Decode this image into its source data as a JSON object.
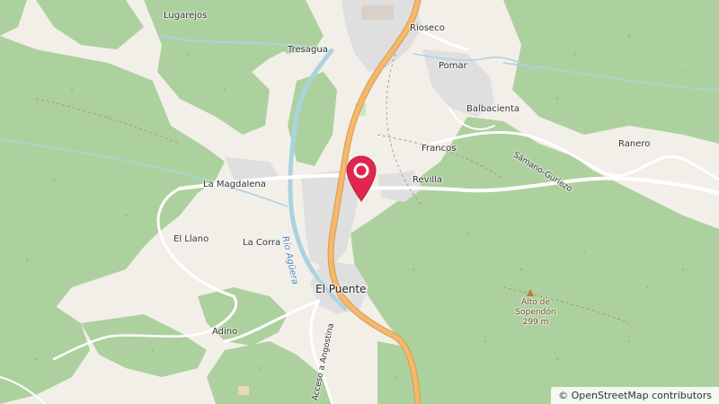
{
  "map": {
    "places": {
      "lugarejos": "Lugarejos",
      "rioseco": "Rioseco",
      "tresagua": "Tresagua",
      "pomar": "Pomar",
      "balbacienta": "Balbacienta",
      "francos": "Francos",
      "ranero": "Ranero",
      "la_magdalena": "La Magdalena",
      "revilla": "Revilla",
      "el_llano": "El Llano",
      "la_corra": "La Corra",
      "el_puente": "El Puente",
      "adino": "Adino"
    },
    "roads": {
      "samano_guriezo": "Sámano-Guriezo",
      "acceso_angostina": "Acceso a Angostina"
    },
    "water": {
      "rio_aguera": "Río Agüera"
    },
    "peak": {
      "name_line1": "Alto de",
      "name_line2": "Sopendón",
      "elevation": "299 m"
    },
    "marker": {
      "label": "location-marker",
      "color": "#e0264f"
    },
    "colors": {
      "forest": "#add19e",
      "residential": "#e0dfdf",
      "background": "#f2efe9",
      "primary_road": "#f4b96c",
      "water": "#aad3df"
    }
  },
  "attribution": {
    "symbol": "©",
    "text": "OpenStreetMap contributors"
  }
}
